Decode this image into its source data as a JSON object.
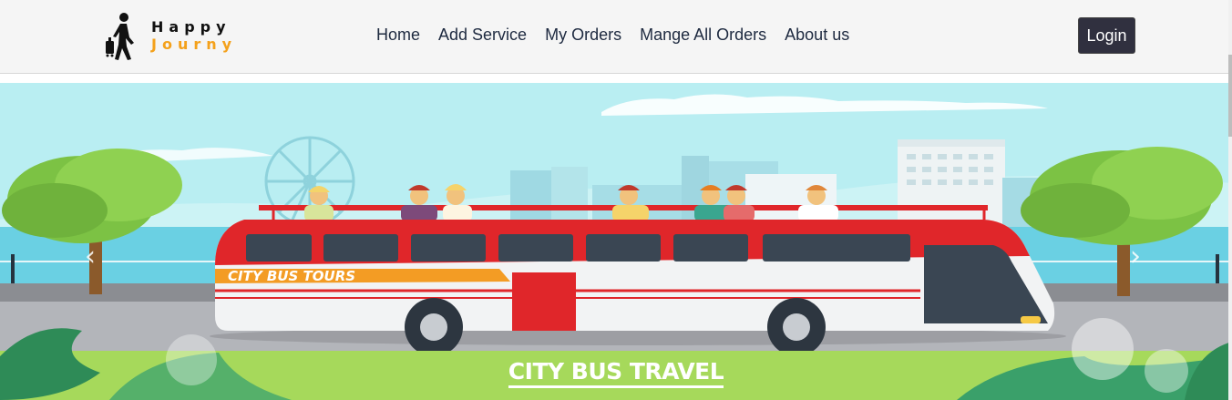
{
  "brand": {
    "line1": "Happy",
    "line2": "Journy",
    "logo_icon": "traveler-with-suitcase-icon"
  },
  "nav": {
    "items": [
      {
        "label": "Home"
      },
      {
        "label": "Add Service"
      },
      {
        "label": "My Orders"
      },
      {
        "label": "Mange All Orders"
      },
      {
        "label": "About us"
      }
    ]
  },
  "login": {
    "label": "Login"
  },
  "hero": {
    "bus_side_text": "CITY BUS TOURS",
    "caption": "CITY BUS TRAVEL",
    "prev_icon": "chevron-left-icon",
    "next_icon": "chevron-right-icon",
    "prev_glyph": "‹",
    "next_glyph": "›"
  },
  "colors": {
    "accent": "#f4a11b",
    "navbar_bg": "#f5f5f5",
    "login_bg": "#30303f",
    "sky": "#b9eef2",
    "bus_red": "#e0262a",
    "grass": "#a6d95b"
  }
}
